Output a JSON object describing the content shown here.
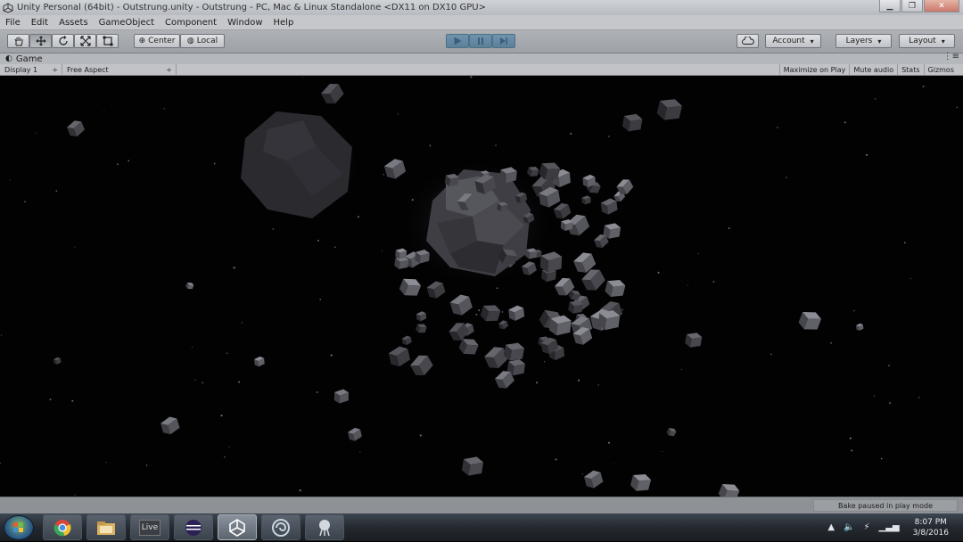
{
  "window": {
    "title": "Unity Personal (64bit) - Outstrung.unity - Outstrung - PC, Mac & Linux Standalone <DX11 on DX10 GPU>",
    "icon": "unity-logo-icon",
    "controls": [
      "minimize-icon",
      "maximize-icon",
      "close-icon"
    ]
  },
  "menu": [
    "File",
    "Edit",
    "Assets",
    "GameObject",
    "Component",
    "Window",
    "Help"
  ],
  "toolbar": {
    "tools": [
      "hand-icon",
      "move-icon",
      "rotate-icon",
      "scale-icon",
      "rect-icon"
    ],
    "pivot_label": "Center",
    "space_label": "Local",
    "playback": [
      "play-icon",
      "pause-icon",
      "step-icon"
    ],
    "cloud_icon": "cloud-icon",
    "account_label": "Account",
    "layers_label": "Layers",
    "layout_label": "Layout"
  },
  "game_tab": {
    "label": "Game",
    "display": "Display 1",
    "aspect": "Free Aspect",
    "buttons": {
      "maximize": "Maximize on Play",
      "mute": "Mute audio",
      "stats": "Stats",
      "gizmos": "Gizmos"
    }
  },
  "status": {
    "message": "Bake paused in play mode"
  },
  "taskbar": {
    "apps": [
      "chrome-icon",
      "file-explorer-icon",
      "live-icon",
      "eclipse-icon",
      "unity-icon",
      "app-swirl-icon",
      "app-paint-icon"
    ],
    "live_label": "Live",
    "time": "8:07 PM",
    "date": "3/8/2016"
  },
  "colors": {
    "accent_play": "#5d8099",
    "scene_background": "#020203",
    "cube_color": "#5a5a60"
  }
}
